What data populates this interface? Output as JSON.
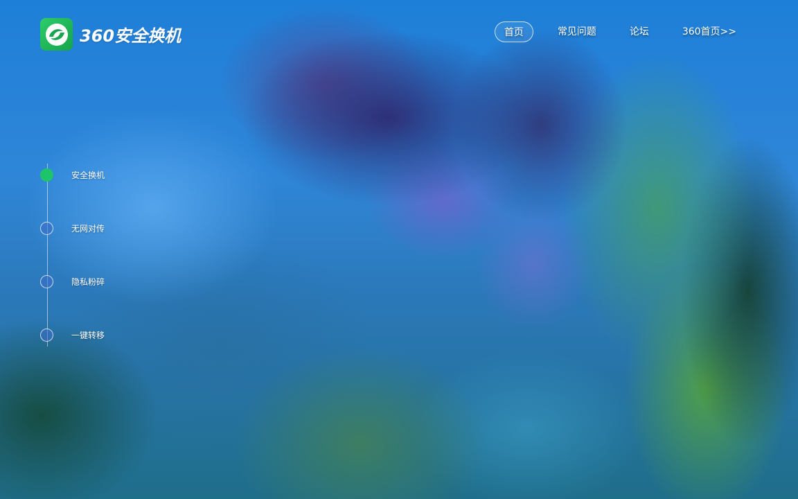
{
  "brand": {
    "name": "360安全换机",
    "logo_color": "#1ec46a"
  },
  "nav": {
    "items": [
      {
        "label": "首页",
        "active": true
      },
      {
        "label": "常见问题",
        "active": false
      },
      {
        "label": "论坛",
        "active": false
      },
      {
        "label": "360首页>>",
        "active": false
      }
    ]
  },
  "timeline": {
    "items": [
      {
        "label": "安全换机",
        "active": true
      },
      {
        "label": "无网对传",
        "active": false
      },
      {
        "label": "隐私粉碎",
        "active": false
      },
      {
        "label": "一键转移",
        "active": false
      }
    ],
    "active_color": "#1ec46a"
  }
}
